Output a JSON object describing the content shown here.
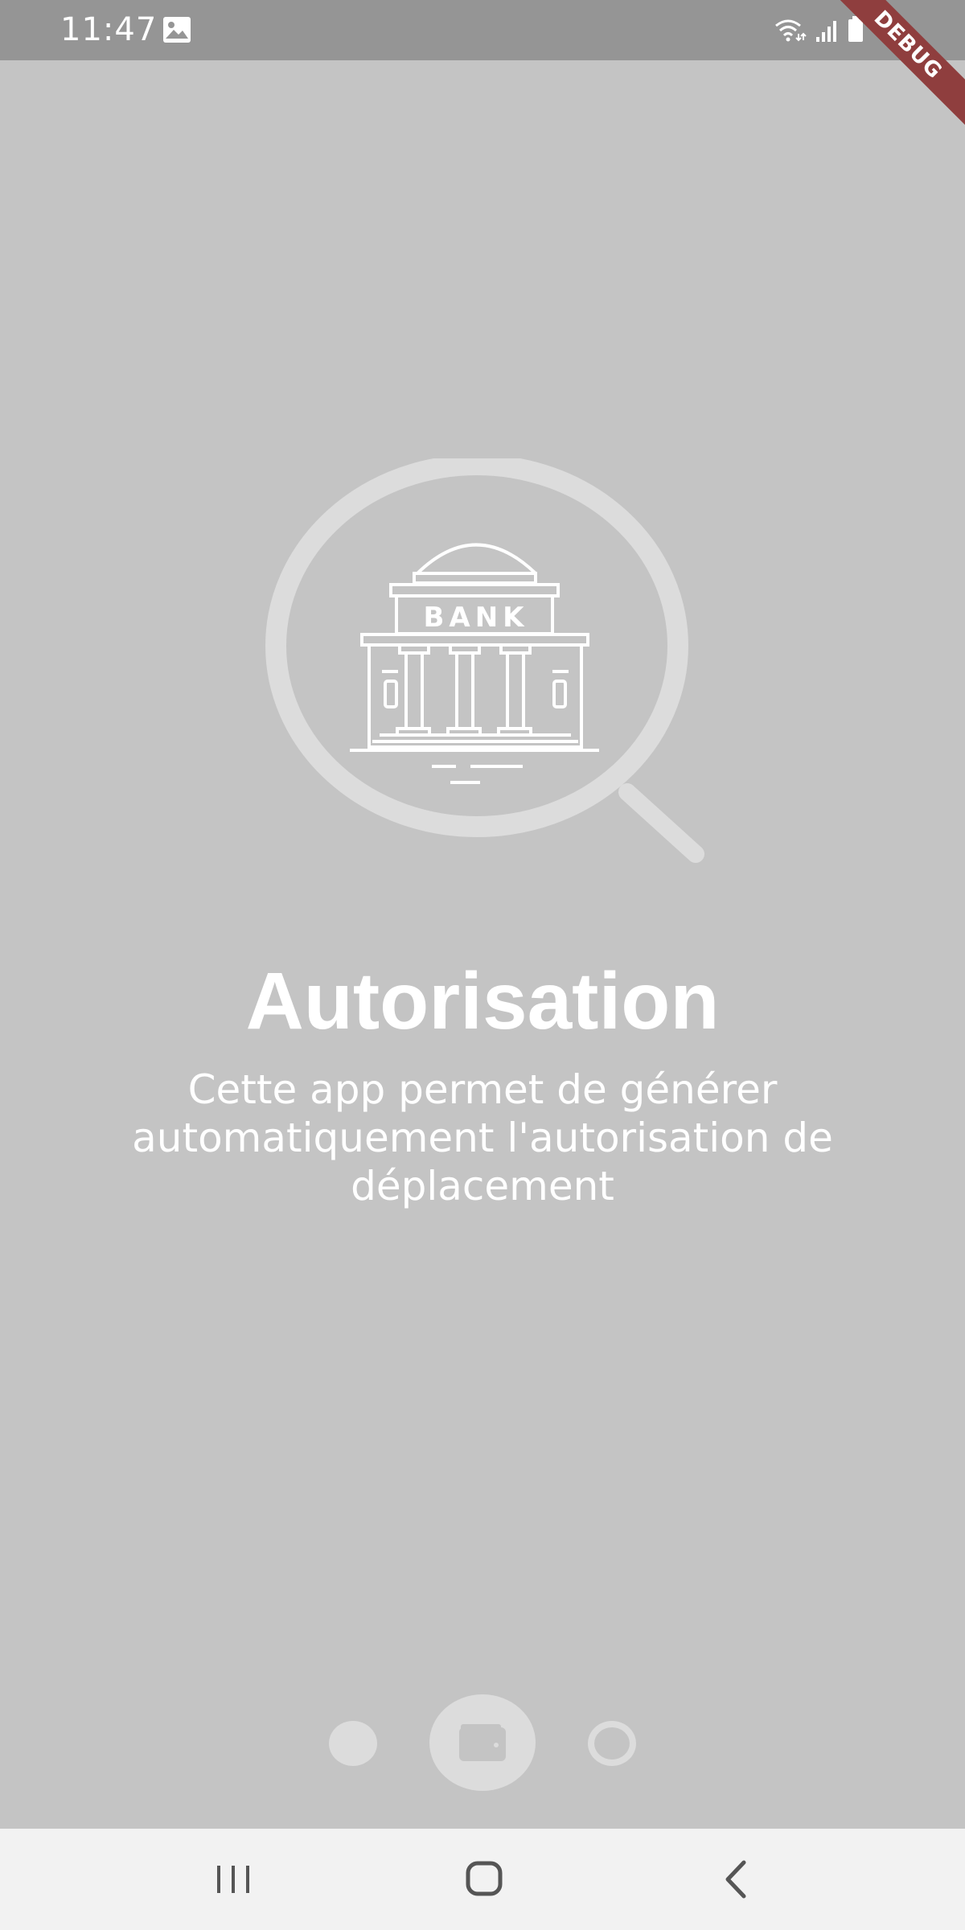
{
  "status_bar": {
    "time": "11:47",
    "left_icons": [
      "image-icon"
    ],
    "right_icons": [
      "wifi-icon",
      "signal-icon",
      "battery-icon"
    ]
  },
  "debug_banner": {
    "label": "DEBUG",
    "color": "#8f3e3e"
  },
  "onboarding": {
    "illustration": {
      "icon": "bank-magnifier-icon",
      "bank_label": "BANK"
    },
    "title": "Autorisation",
    "description": "Cette app permet de générer automatiquement l'autorisation de déplacement"
  },
  "page_indicator": {
    "current_page": 2,
    "total_pages": 3,
    "items": [
      {
        "state": "filled"
      },
      {
        "state": "active",
        "icon": "wallet-icon"
      },
      {
        "state": "outline"
      }
    ]
  },
  "nav_bar": {
    "buttons": [
      "recents-icon",
      "home-icon",
      "back-icon"
    ]
  },
  "colors": {
    "background": "#c4c4c4",
    "status_bar": "#959595",
    "text": "#ffffff",
    "indicator": "#dcdcdc",
    "nav_bar": "#f2f2f2"
  }
}
